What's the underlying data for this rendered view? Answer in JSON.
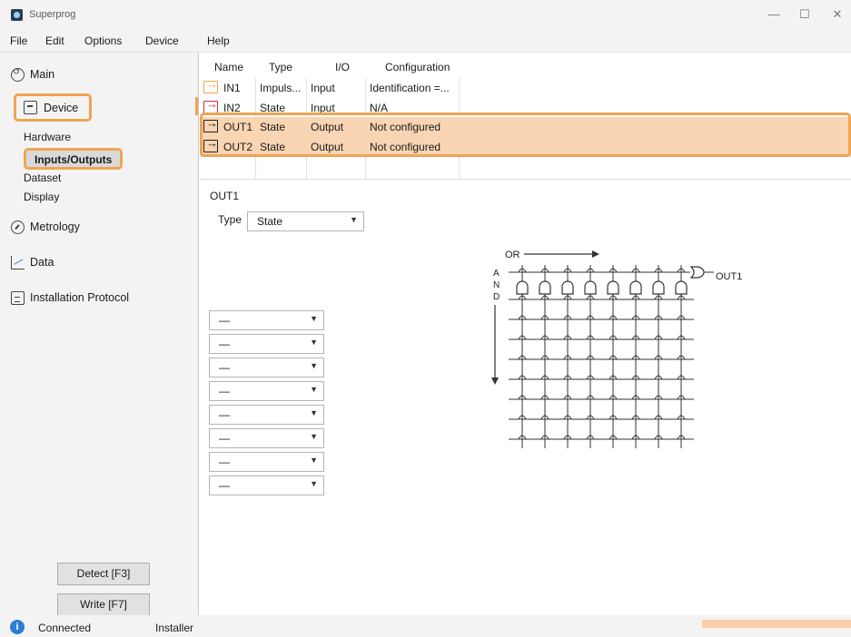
{
  "window": {
    "title": "Superprog",
    "controls": {
      "minimize": "—",
      "maximize": "☐",
      "close": "✕"
    }
  },
  "menu": [
    "File",
    "Edit",
    "Options",
    "Device",
    "Help"
  ],
  "sidebar": {
    "main_label": "Main",
    "device_label": "Device",
    "device_items": [
      "Hardware",
      "Inputs/Outputs",
      "Dataset",
      "Display"
    ],
    "selected_device_item": "Inputs/Outputs",
    "metrology_label": "Metrology",
    "data_label": "Data",
    "installation_label": "Installation Protocol",
    "detect_button": "Detect [F3]",
    "write_button": "Write [F7]"
  },
  "io_table": {
    "headers": {
      "name": "Name",
      "type": "Type",
      "io": "I/O",
      "configuration": "Configuration"
    },
    "rows": [
      {
        "name": "IN1",
        "type": "Impuls...",
        "io": "Input",
        "configuration": "Identification =...",
        "icon_color": "#f0a451"
      },
      {
        "name": "IN2",
        "type": "State",
        "io": "Input",
        "configuration": "N/A",
        "icon_color": "#d62b3a"
      },
      {
        "name": "OUT1",
        "type": "State",
        "io": "Output",
        "configuration": "Not configured",
        "icon_color": "#222222"
      },
      {
        "name": "OUT2",
        "type": "State",
        "io": "Output",
        "configuration": "Not configured",
        "icon_color": "#222222"
      }
    ],
    "selected_rows": [
      "OUT1",
      "OUT2"
    ]
  },
  "detail": {
    "output_name": "OUT1",
    "type_label": "Type",
    "type_value": "State",
    "condition_values": [
      "—",
      "—",
      "—",
      "—",
      "—",
      "—",
      "—",
      "—"
    ]
  },
  "diagram": {
    "or_label": "OR",
    "and_label": [
      "A",
      "N",
      "D"
    ],
    "output_label": "OUT1",
    "columns": 8,
    "rows": 9
  },
  "status": {
    "connection": "Connected",
    "role": "Installer"
  },
  "colors": {
    "accent": "#f0a451",
    "selection": "#fad5b3",
    "info": "#2d7dd2"
  },
  "icons": {
    "main": "refresh-icon",
    "device": "device-icon",
    "metrology": "gauge-icon",
    "data": "chart-icon",
    "installation": "document-icon",
    "status": "info-icon"
  }
}
